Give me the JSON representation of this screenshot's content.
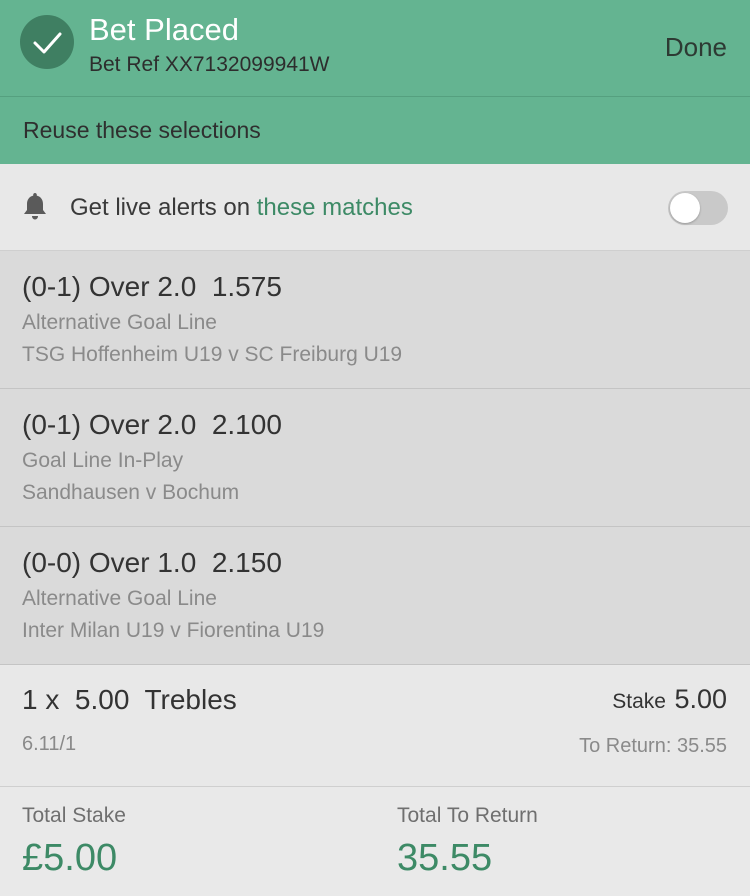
{
  "colors": {
    "header_bg": "#64b491",
    "accent": "#3d8a66",
    "check_circle": "#3f7f62"
  },
  "header": {
    "icon": "checkmark-icon",
    "title": "Bet Placed",
    "bet_ref": "Bet Ref XX7132099941W",
    "done_label": "Done"
  },
  "reuse": {
    "label": "Reuse these selections"
  },
  "alerts": {
    "icon": "bell-icon",
    "text": "Get live alerts on ",
    "link": "these matches",
    "toggle_on": false
  },
  "selections": [
    {
      "line": "(0-1) Over 2.0  1.575",
      "market": "Alternative Goal Line",
      "event": "TSG Hoffenheim U19 v SC Freiburg U19"
    },
    {
      "line": "(0-1) Over 2.0  2.100",
      "market": "Goal Line In-Play",
      "event": "Sandhausen v Bochum"
    },
    {
      "line": "(0-0) Over 1.0  2.150",
      "market": "Alternative Goal Line",
      "event": "Inter Milan U19 v Fiorentina U19"
    }
  ],
  "bet": {
    "type": "1 x  5.00  Trebles",
    "odds": "6.11/1",
    "stake_label": "Stake",
    "stake_value": "5.00",
    "to_return": "To Return: 35.55"
  },
  "totals": {
    "stake_label": "Total Stake",
    "stake_value": "£5.00",
    "return_label": "Total To Return",
    "return_value": "35.55"
  }
}
